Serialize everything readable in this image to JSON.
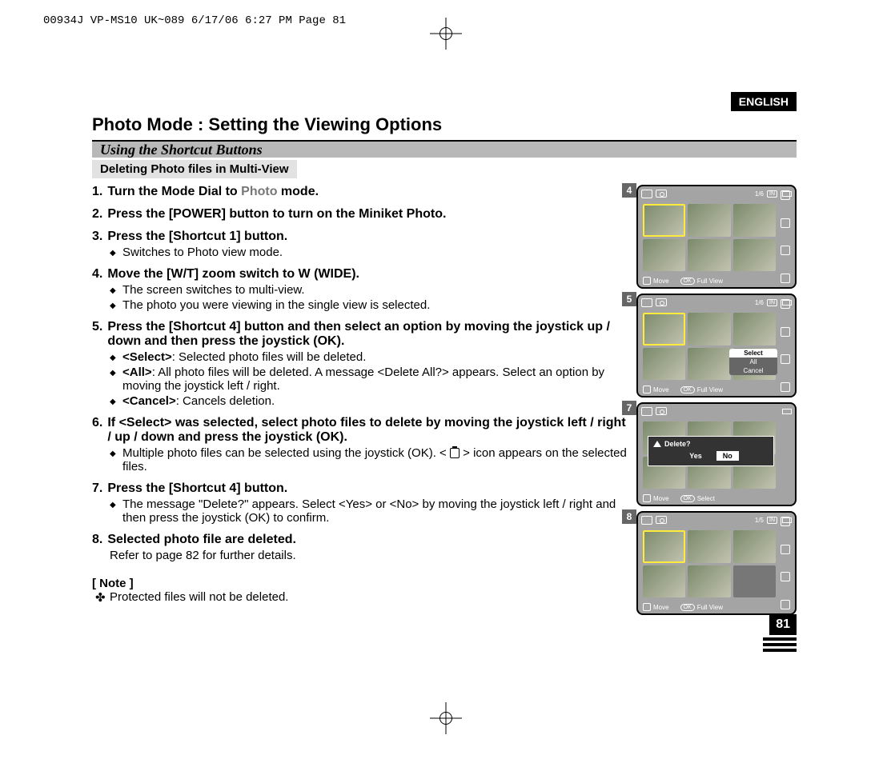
{
  "print_header": "00934J VP-MS10 UK~089  6/17/06 6:27 PM  Page 81",
  "language": "ENGLISH",
  "section_title": "Photo Mode : Setting the Viewing Options",
  "subtitle": "Using the Shortcut Buttons",
  "sub_box": "Deleting Photo files in Multi-View",
  "page_number": "81",
  "steps": [
    {
      "n": "1.",
      "head_pre": "Turn the Mode Dial to ",
      "head_em": "Photo",
      "head_post": " mode.",
      "subs": []
    },
    {
      "n": "2.",
      "head": "Press the [POWER] button to turn on the Miniket Photo.",
      "subs": []
    },
    {
      "n": "3.",
      "head": "Press the [Shortcut 1] button.",
      "subs": [
        "Switches to Photo view mode."
      ]
    },
    {
      "n": "4.",
      "head": "Move the [W/T] zoom switch to W (WIDE).",
      "subs": [
        "The screen switches to multi-view.",
        "The photo you were viewing in the single view is selected."
      ]
    },
    {
      "n": "5.",
      "head": "Press the [Shortcut 4] button and then select an option by moving the joystick up / down and then press the joystick (OK).",
      "subs_rich": [
        {
          "b": "<Select>",
          "t": ": Selected photo files will be deleted."
        },
        {
          "b": "<All>",
          "t": ": All photo files will be deleted. A message <Delete All?> appears. Select an option by moving the joystick left / right."
        },
        {
          "b": "<Cancel>",
          "t": ": Cancels deletion."
        }
      ]
    },
    {
      "n": "6.",
      "head": "If <Select> was selected, select photo files to delete by moving the joystick left / right / up / down and press the joystick (OK).",
      "subs_inline": [
        {
          "pre": "Multiple photo files can be selected using the joystick (OK). < ",
          "post": " > icon appears on the selected files."
        }
      ]
    },
    {
      "n": "7.",
      "head": "Press the [Shortcut 4] button.",
      "subs": [
        "The message \"Delete?\" appears. Select <Yes> or <No> by moving the joystick left / right and then press the joystick (OK) to confirm."
      ]
    },
    {
      "n": "8.",
      "head": "Selected photo file are deleted.",
      "trail": "Refer to page 82 for further details."
    }
  ],
  "note_head": "[ Note ]",
  "note_item": "Protected files will not be deleted.",
  "figures": {
    "shot4": {
      "num": "4",
      "counter": "1/6",
      "in": "IN",
      "move": "Move",
      "ok": "OK",
      "full": "Full View"
    },
    "shot5": {
      "num": "5",
      "counter": "1/6",
      "in": "IN",
      "move": "Move",
      "ok": "OK",
      "full": "Full View",
      "menu": [
        "Select",
        "All",
        "Cancel"
      ]
    },
    "shot7": {
      "num": "7",
      "move": "Move",
      "ok": "OK",
      "select": "Select",
      "dialog_title": "Delete?",
      "yes": "Yes",
      "no": "No"
    },
    "shot8": {
      "num": "8",
      "counter": "1/5",
      "in": "IN",
      "move": "Move",
      "ok": "OK",
      "full": "Full View"
    }
  }
}
